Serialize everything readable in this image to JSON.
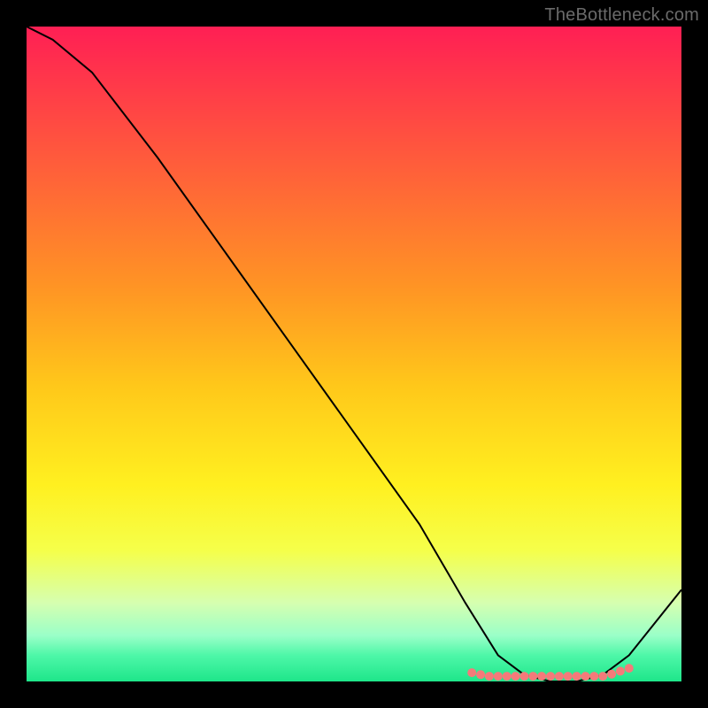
{
  "watermark": "TheBottleneck.com",
  "chart_data": {
    "type": "line",
    "title": "",
    "xlabel": "",
    "ylabel": "",
    "xlim": [
      0,
      100
    ],
    "ylim": [
      0,
      100
    ],
    "series": [
      {
        "name": "curve",
        "x": [
          0,
          4,
          10,
          20,
          30,
          40,
          50,
          60,
          67,
          72,
          76,
          80,
          84,
          88,
          92,
          100
        ],
        "y": [
          100,
          98,
          93,
          80,
          66,
          52,
          38,
          24,
          12,
          4,
          1,
          0,
          0,
          1,
          4,
          14
        ]
      }
    ],
    "flat_region": {
      "x_from": 68,
      "x_to": 92,
      "y": 0.8,
      "marker_color": "#f47a7a",
      "marker_radius_px": 5
    },
    "gradient_stops": [
      {
        "offset": 0.0,
        "color": "#ff1f54"
      },
      {
        "offset": 0.2,
        "color": "#ff5a3c"
      },
      {
        "offset": 0.4,
        "color": "#ff9524"
      },
      {
        "offset": 0.55,
        "color": "#ffc81a"
      },
      {
        "offset": 0.7,
        "color": "#fff020"
      },
      {
        "offset": 0.8,
        "color": "#f5ff4a"
      },
      {
        "offset": 0.88,
        "color": "#d6ffb0"
      },
      {
        "offset": 0.93,
        "color": "#9affc8"
      },
      {
        "offset": 0.96,
        "color": "#4ef7a8"
      },
      {
        "offset": 1.0,
        "color": "#1ee68a"
      }
    ]
  }
}
